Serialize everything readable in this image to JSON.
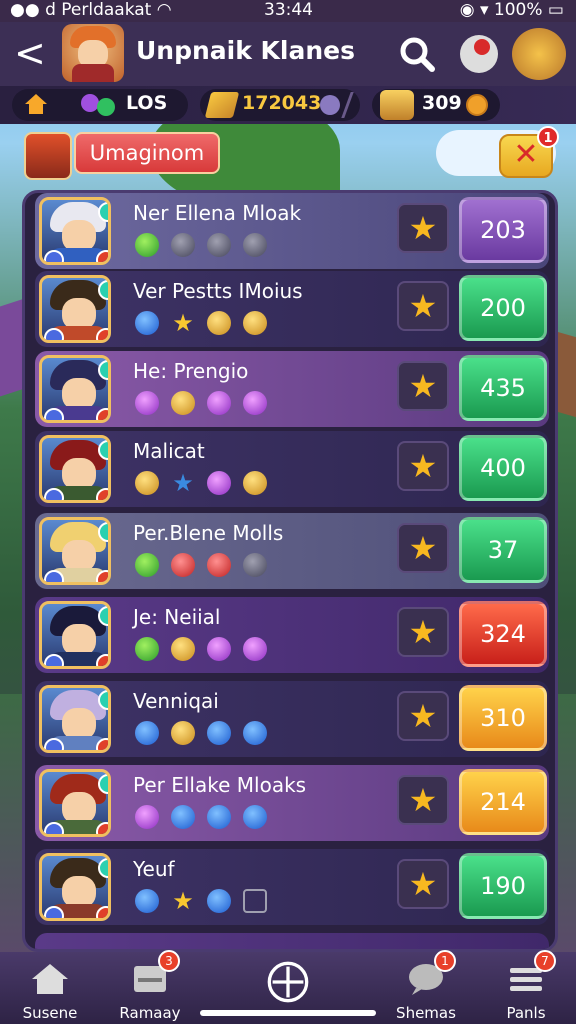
{
  "status_bar": {
    "left": "d Perldaakat",
    "time": "33:44",
    "battery": "100%"
  },
  "header": {
    "back_label": "<",
    "title": "Unpnaik Klanes"
  },
  "resources": {
    "los_label": "LOS",
    "gold_amount": "172043",
    "chest_amount": "309"
  },
  "section": {
    "label": "Umaginom",
    "close_label": "✕",
    "close_badge": "1"
  },
  "rows": [
    {
      "name": "Ner Ellena Mloak",
      "score": "203",
      "score_color": "purple",
      "gems": [
        "green",
        "grey",
        "grey",
        "grey"
      ]
    },
    {
      "name": "Ver Pestts IMoius",
      "score": "200",
      "score_color": "green",
      "gems": [
        "blue",
        "star",
        "gold",
        "gold"
      ]
    },
    {
      "name": "He: Prengio",
      "score": "435",
      "score_color": "green",
      "gems": [
        "purple",
        "gold",
        "purple",
        "purple"
      ]
    },
    {
      "name": "Malicat",
      "score": "400",
      "score_color": "green",
      "gems": [
        "gold",
        "starblue",
        "purple",
        "gold"
      ]
    },
    {
      "name": "Per.Blene Molls",
      "score": "37",
      "score_color": "green",
      "gems": [
        "green",
        "red",
        "red",
        "grey"
      ]
    },
    {
      "name": "Je: Neiial",
      "score": "324",
      "score_color": "red",
      "gems": [
        "green",
        "gold",
        "purple",
        "purple"
      ]
    },
    {
      "name": "Venniqai",
      "score": "310",
      "score_color": "orange",
      "gems": [
        "blue",
        "gold",
        "blue",
        "blue"
      ]
    },
    {
      "name": "Per Ellake Mloaks",
      "score": "214",
      "score_color": "orange",
      "gems": [
        "purple",
        "blue",
        "blue",
        "blue"
      ]
    },
    {
      "name": "Yeuf",
      "score": "190",
      "score_color": "green",
      "gems": [
        "blue",
        "star",
        "blue",
        "box"
      ]
    }
  ],
  "nav": {
    "items": [
      {
        "label": "Susene",
        "icon": "home-icon",
        "badge": ""
      },
      {
        "label": "Ramaay",
        "icon": "inbox-icon",
        "badge": "3"
      },
      {
        "label": "",
        "icon": "crosshair-icon",
        "badge": ""
      },
      {
        "label": "Shemas",
        "icon": "chat-icon",
        "badge": "1"
      },
      {
        "label": "Panls",
        "icon": "menu-icon",
        "badge": "7"
      }
    ]
  },
  "colors": {
    "topbar": "#3c2f55",
    "panel": "#2a2140",
    "accent_gold": "#f8c840",
    "accent_red": "#d83a3a"
  }
}
